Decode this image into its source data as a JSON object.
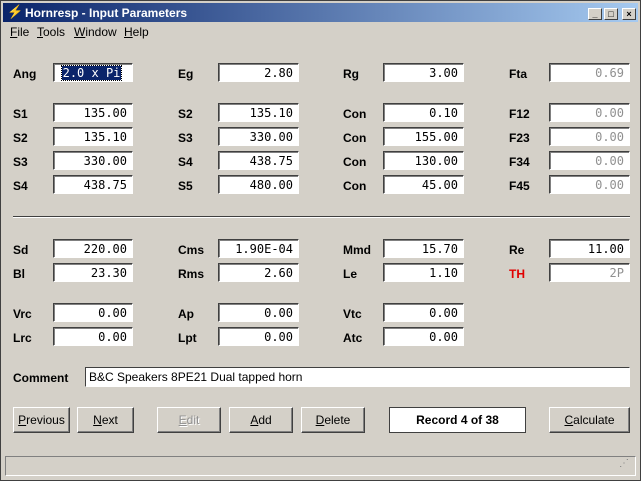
{
  "window": {
    "title": "Hornresp - Input Parameters",
    "minimize": "_",
    "maximize": "□",
    "close": "×"
  },
  "menu": [
    "File",
    "Tools",
    "Window",
    "Help"
  ],
  "params": {
    "ang": {
      "label": "Ang",
      "value": "2.0 x Pi"
    },
    "eg": {
      "label": "Eg",
      "value": "2.80"
    },
    "rg": {
      "label": "Rg",
      "value": "3.00"
    },
    "fta": {
      "label": "Fta",
      "value": "0.69"
    },
    "s1": {
      "label": "S1",
      "value": "135.00"
    },
    "s2a": {
      "label": "S2",
      "value": "135.10"
    },
    "con1": {
      "label": "Con",
      "value": "0.10"
    },
    "f12": {
      "label": "F12",
      "value": "0.00"
    },
    "s2b": {
      "label": "S2",
      "value": "135.10"
    },
    "s3a": {
      "label": "S3",
      "value": "330.00"
    },
    "con2": {
      "label": "Con",
      "value": "155.00"
    },
    "f23": {
      "label": "F23",
      "value": "0.00"
    },
    "s3b": {
      "label": "S3",
      "value": "330.00"
    },
    "s4a": {
      "label": "S4",
      "value": "438.75"
    },
    "con3": {
      "label": "Con",
      "value": "130.00"
    },
    "f34": {
      "label": "F34",
      "value": "0.00"
    },
    "s4b": {
      "label": "S4",
      "value": "438.75"
    },
    "s5": {
      "label": "S5",
      "value": "480.00"
    },
    "con4": {
      "label": "Con",
      "value": "45.00"
    },
    "f45": {
      "label": "F45",
      "value": "0.00"
    },
    "sd": {
      "label": "Sd",
      "value": "220.00"
    },
    "cms": {
      "label": "Cms",
      "value": "1.90E-04"
    },
    "mmd": {
      "label": "Mmd",
      "value": "15.70"
    },
    "re": {
      "label": "Re",
      "value": "11.00"
    },
    "bl": {
      "label": "Bl",
      "value": "23.30"
    },
    "rms": {
      "label": "Rms",
      "value": "2.60"
    },
    "le": {
      "label": "Le",
      "value": "1.10"
    },
    "th": {
      "label": "TH",
      "value": "2P"
    },
    "vrc": {
      "label": "Vrc",
      "value": "0.00"
    },
    "ap": {
      "label": "Ap",
      "value": "0.00"
    },
    "vtc": {
      "label": "Vtc",
      "value": "0.00"
    },
    "lrc": {
      "label": "Lrc",
      "value": "0.00"
    },
    "lpt": {
      "label": "Lpt",
      "value": "0.00"
    },
    "atc": {
      "label": "Atc",
      "value": "0.00"
    }
  },
  "comment": {
    "label": "Comment",
    "value": "B&C Speakers 8PE21 Dual tapped horn"
  },
  "buttons": {
    "previous": "Previous",
    "next": "Next",
    "edit": "Edit",
    "add": "Add",
    "delete": "Delete",
    "calculate": "Calculate"
  },
  "record": "Record 4 of 38",
  "colors": {
    "titlebar": "#0a246a",
    "th_label": "#e00000",
    "face": "#d4d0c8"
  }
}
